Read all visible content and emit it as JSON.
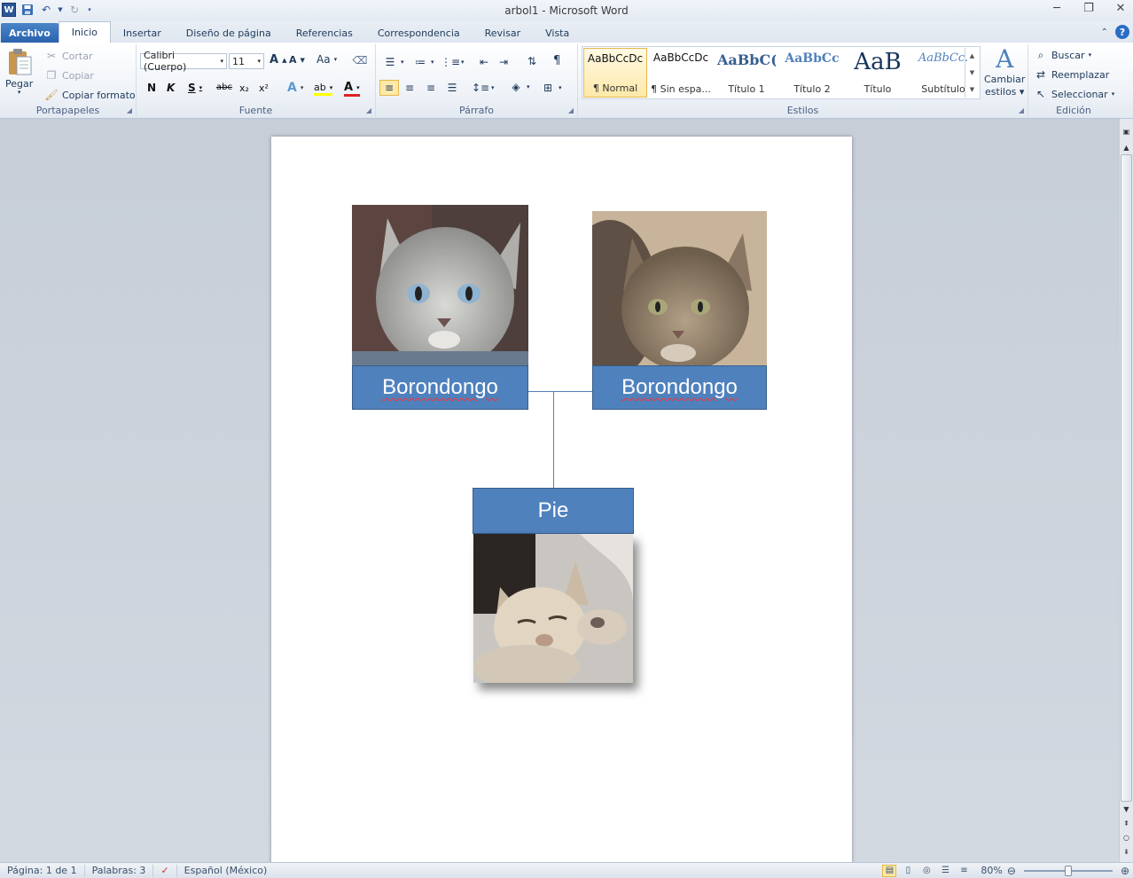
{
  "window": {
    "title": "arbol1  -  Microsoft Word",
    "logo": "W",
    "controls": {
      "minimize": "─",
      "restore": "❐",
      "close": "✕"
    }
  },
  "tabs": [
    {
      "label": "Archivo"
    },
    {
      "label": "Inicio"
    },
    {
      "label": "Insertar"
    },
    {
      "label": "Diseño de página"
    },
    {
      "label": "Referencias"
    },
    {
      "label": "Correspondencia"
    },
    {
      "label": "Revisar"
    },
    {
      "label": "Vista"
    }
  ],
  "ribbon": {
    "clipboard": {
      "label": "Portapapeles",
      "paste": "Pegar",
      "cut": "Cortar",
      "copy": "Copiar",
      "format_painter": "Copiar formato"
    },
    "font": {
      "label": "Fuente",
      "font_name": "Calibri (Cuerpo)",
      "font_size": "11",
      "bold": "N",
      "italic": "K",
      "underline": "S",
      "strikethrough": "abc",
      "subscript": "x₂",
      "superscript": "x²",
      "grow": "A",
      "shrink": "A",
      "case": "Aa",
      "text_effects": "A",
      "highlight": "ab",
      "font_color": "A"
    },
    "paragraph": {
      "label": "Párrafo",
      "show_marks": "¶"
    },
    "styles": {
      "label": "Estilos",
      "items": [
        {
          "sample": "AaBbCcDc",
          "name": "¶ Normal"
        },
        {
          "sample": "AaBbCcDc",
          "name": "¶ Sin espa..."
        },
        {
          "sample": "AaBbC(",
          "name": "Título 1"
        },
        {
          "sample": "AaBbCc",
          "name": "Título 2"
        },
        {
          "sample": "AaB",
          "name": "Título"
        },
        {
          "sample": "AaBbCc.",
          "name": "Subtítulo"
        }
      ],
      "change_styles_line1": "Cambiar",
      "change_styles_line2": "estilos"
    },
    "editing": {
      "label": "Edición",
      "find": "Buscar",
      "replace": "Reemplazar",
      "select": "Seleccionar"
    }
  },
  "document": {
    "parent_left": {
      "name": "Borondongo"
    },
    "parent_right": {
      "name": "Borondongo"
    },
    "child": {
      "name": "Pie"
    }
  },
  "statusbar": {
    "page": "Página: 1 de 1",
    "words": "Palabras: 3",
    "language": "Español (México)",
    "zoom": "80%"
  },
  "colors": {
    "shape_fill": "#4f81bd",
    "shape_border": "#385d8a",
    "file_tab": "#2a62ac"
  }
}
